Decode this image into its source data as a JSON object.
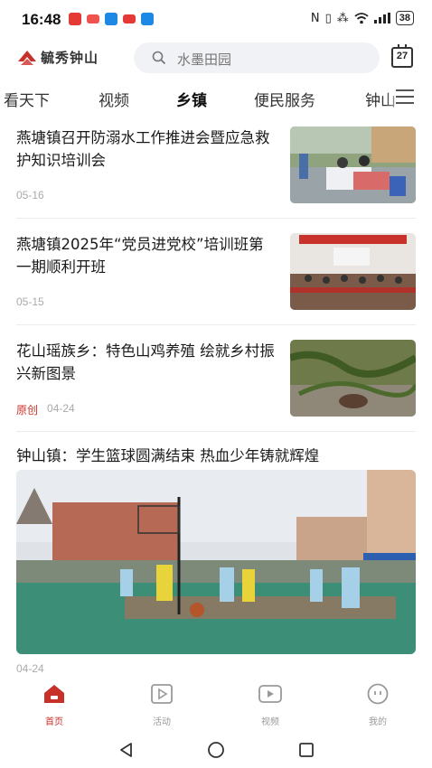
{
  "status_bar": {
    "time": "16:48",
    "battery": "38"
  },
  "header": {
    "app_name": "毓秀钟山",
    "search_placeholder": "水墨田园",
    "calendar_day": "27"
  },
  "tabs": [
    {
      "label": "看天下",
      "active": false
    },
    {
      "label": "视频",
      "active": false
    },
    {
      "label": "乡镇",
      "active": true
    },
    {
      "label": "便民服务",
      "active": false
    },
    {
      "label": "钟山",
      "active": false
    }
  ],
  "articles": [
    {
      "title": "燕塘镇召开防溺水工作推进会暨应急救护知识培训会",
      "tag": "",
      "date": "05-16"
    },
    {
      "title": "燕塘镇2025年“党员进党校”培训班第一期顺利开班",
      "tag": "",
      "date": "05-15"
    },
    {
      "title": "花山瑶族乡：特色山鸡养殖 绘就乡村振兴新图景",
      "tag": "原创",
      "date": "04-24"
    }
  ],
  "featured": {
    "title": "钟山镇：学生篮球圆满结束 热血少年铸就辉煌",
    "date": "04-24"
  },
  "bottom_nav": [
    {
      "label": "首页",
      "icon": "home-icon",
      "active": true
    },
    {
      "label": "活动",
      "icon": "activity-icon",
      "active": false
    },
    {
      "label": "视频",
      "icon": "video-icon",
      "active": false
    },
    {
      "label": "我的",
      "icon": "profile-icon",
      "active": false
    }
  ],
  "colors": {
    "accent": "#c8312a",
    "tag_red": "#d0322a"
  }
}
